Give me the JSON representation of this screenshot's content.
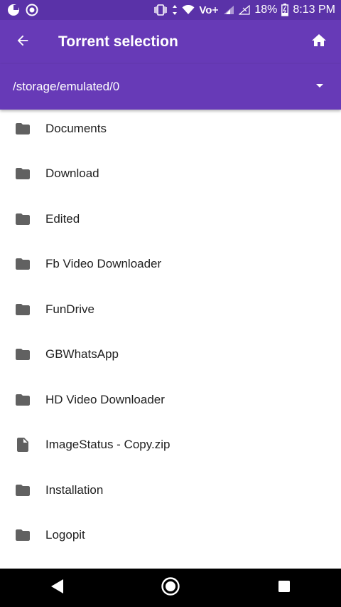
{
  "status_bar": {
    "battery": "18%",
    "time": "8:13 PM",
    "network_label": "Vo",
    "icons": [
      "notification-icon",
      "circle-icon",
      "vibrate-icon",
      "data-arrows-icon",
      "wifi-icon",
      "volte-icon",
      "signal-icon",
      "no-signal-icon",
      "battery-charging-icon"
    ]
  },
  "app_bar": {
    "title": "Torrent selection",
    "back_icon": "arrow-back-icon",
    "home_icon": "home-icon"
  },
  "path_bar": {
    "path": "/storage/emulated/0",
    "dropdown_icon": "arrow-drop-down-icon"
  },
  "files": [
    {
      "name": "Documents",
      "type": "folder"
    },
    {
      "name": "Download",
      "type": "folder"
    },
    {
      "name": "Edited",
      "type": "folder"
    },
    {
      "name": "Fb Video Downloader",
      "type": "folder"
    },
    {
      "name": "FunDrive",
      "type": "folder"
    },
    {
      "name": "GBWhatsApp",
      "type": "folder"
    },
    {
      "name": "HD Video Downloader",
      "type": "folder"
    },
    {
      "name": "ImageStatus - Copy.zip",
      "type": "file"
    },
    {
      "name": "Installation",
      "type": "folder"
    },
    {
      "name": "Logopit",
      "type": "folder"
    }
  ],
  "colors": {
    "primary": "#673ab7",
    "status_bar": "#5a32a8",
    "icon_gray": "#616161",
    "nav_bar": "#000000"
  }
}
